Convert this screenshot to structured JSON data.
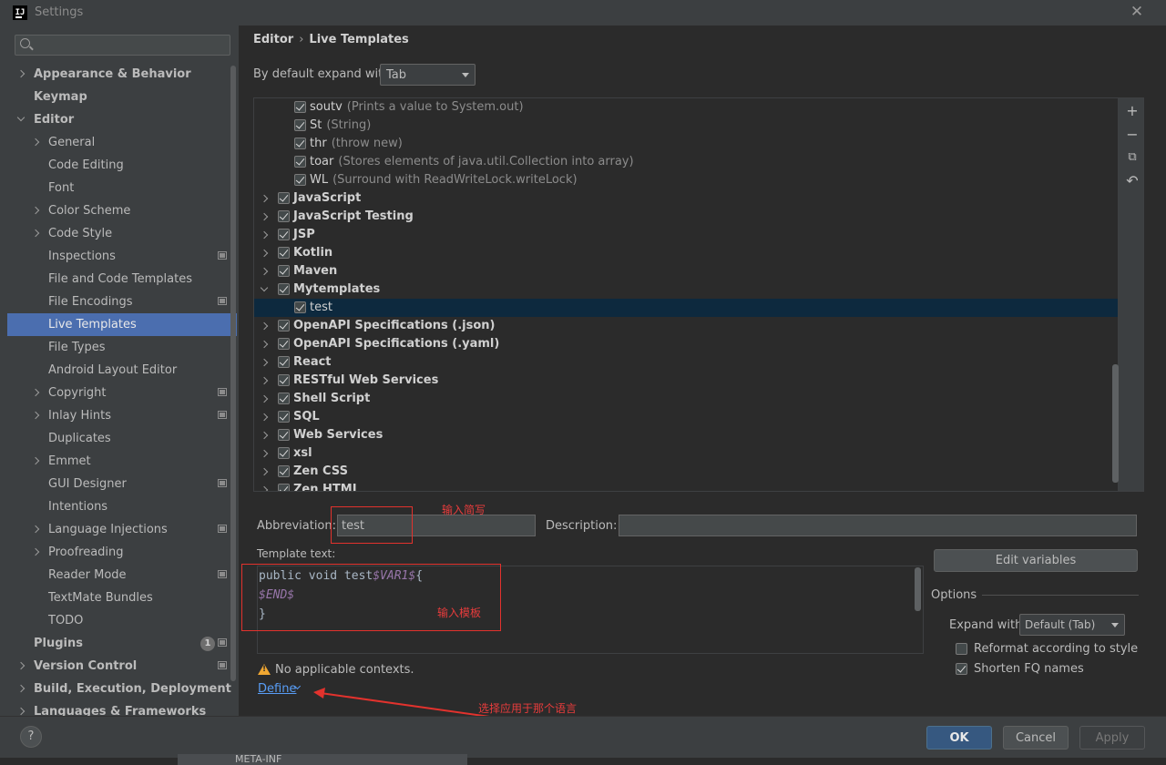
{
  "window": {
    "title": "Settings",
    "logo_text": "IJ",
    "close_glyph": "✕"
  },
  "search": {
    "placeholder": ""
  },
  "sidebar": {
    "items": [
      {
        "label": "Appearance & Behavior",
        "bold": true,
        "chevron": "closed",
        "indent": 0
      },
      {
        "label": "Keymap",
        "bold": true,
        "indent": 0
      },
      {
        "label": "Editor",
        "bold": true,
        "chevron": "open",
        "indent": 0
      },
      {
        "label": "General",
        "chevron": "closed",
        "indent": 1
      },
      {
        "label": "Code Editing",
        "indent": 1
      },
      {
        "label": "Font",
        "indent": 1
      },
      {
        "label": "Color Scheme",
        "chevron": "closed",
        "indent": 1
      },
      {
        "label": "Code Style",
        "chevron": "closed",
        "indent": 1
      },
      {
        "label": "Inspections",
        "indent": 1,
        "settings_icon": true
      },
      {
        "label": "File and Code Templates",
        "indent": 1
      },
      {
        "label": "File Encodings",
        "indent": 1,
        "settings_icon": true
      },
      {
        "label": "Live Templates",
        "indent": 1,
        "selected": true
      },
      {
        "label": "File Types",
        "indent": 1
      },
      {
        "label": "Android Layout Editor",
        "indent": 1
      },
      {
        "label": "Copyright",
        "chevron": "closed",
        "indent": 1,
        "settings_icon": true
      },
      {
        "label": "Inlay Hints",
        "chevron": "closed",
        "indent": 1,
        "settings_icon": true
      },
      {
        "label": "Duplicates",
        "indent": 1
      },
      {
        "label": "Emmet",
        "chevron": "closed",
        "indent": 1
      },
      {
        "label": "GUI Designer",
        "indent": 1,
        "settings_icon": true
      },
      {
        "label": "Intentions",
        "indent": 1
      },
      {
        "label": "Language Injections",
        "chevron": "closed",
        "indent": 1,
        "settings_icon": true
      },
      {
        "label": "Proofreading",
        "chevron": "closed",
        "indent": 1
      },
      {
        "label": "Reader Mode",
        "indent": 1,
        "settings_icon": true
      },
      {
        "label": "TextMate Bundles",
        "indent": 1
      },
      {
        "label": "TODO",
        "indent": 1
      },
      {
        "label": "Plugins",
        "bold": true,
        "indent": 0,
        "badge": "1",
        "settings_icon": true
      },
      {
        "label": "Version Control",
        "bold": true,
        "chevron": "closed",
        "indent": 0,
        "settings_icon": true
      },
      {
        "label": "Build, Execution, Deployment",
        "bold": true,
        "chevron": "closed",
        "indent": 0
      },
      {
        "label": "Languages & Frameworks",
        "bold": true,
        "chevron": "closed",
        "indent": 0
      }
    ]
  },
  "breadcrumb": {
    "parent": "Editor",
    "separator": "›",
    "current": "Live Templates"
  },
  "expand_default": {
    "label": "By default expand with",
    "value": "Tab"
  },
  "tree": {
    "rows": [
      {
        "type": "item",
        "name": "soutv",
        "desc": "(Prints a value to System.out)"
      },
      {
        "type": "item",
        "name": "St",
        "desc": "(String)"
      },
      {
        "type": "item",
        "name": "thr",
        "desc": "(throw new)"
      },
      {
        "type": "item",
        "name": "toar",
        "desc": "(Stores elements of java.util.Collection into array)"
      },
      {
        "type": "item",
        "name": "WL",
        "desc": "(Surround with ReadWriteLock.writeLock)"
      },
      {
        "type": "group",
        "name": "JavaScript",
        "open": false
      },
      {
        "type": "group",
        "name": "JavaScript Testing",
        "open": false
      },
      {
        "type": "group",
        "name": "JSP",
        "open": false
      },
      {
        "type": "group",
        "name": "Kotlin",
        "open": false
      },
      {
        "type": "group",
        "name": "Maven",
        "open": false
      },
      {
        "type": "group",
        "name": "Mytemplates",
        "open": true
      },
      {
        "type": "item",
        "name": "test",
        "desc": "",
        "selected": true
      },
      {
        "type": "group",
        "name": "OpenAPI Specifications (.json)",
        "open": false
      },
      {
        "type": "group",
        "name": "OpenAPI Specifications (.yaml)",
        "open": false
      },
      {
        "type": "group",
        "name": "React",
        "open": false
      },
      {
        "type": "group",
        "name": "RESTful Web Services",
        "open": false
      },
      {
        "type": "group",
        "name": "Shell Script",
        "open": false
      },
      {
        "type": "group",
        "name": "SQL",
        "open": false
      },
      {
        "type": "group",
        "name": "Web Services",
        "open": false
      },
      {
        "type": "group",
        "name": "xsl",
        "open": false
      },
      {
        "type": "group",
        "name": "Zen CSS",
        "open": false
      },
      {
        "type": "group",
        "name": "Zen HTML",
        "open": false
      }
    ],
    "toolbar": {
      "add": "+",
      "remove": "−",
      "copy": "⧉",
      "restore": "↶"
    }
  },
  "editor": {
    "abbreviation_label": "Abbreviation:",
    "abbreviation_value": "test",
    "description_label": "Description:",
    "description_value": "",
    "template_text_label": "Template text:",
    "code_lines": [
      [
        {
          "t": "public void test",
          "c": "plain"
        },
        {
          "t": "$VAR1$",
          "c": "var"
        },
        {
          "t": "{",
          "c": "plain"
        }
      ],
      [
        {
          "t": "$END$",
          "c": "var"
        }
      ],
      [
        {
          "t": "}",
          "c": "plain"
        }
      ]
    ],
    "edit_variables_label": "Edit variables",
    "options_label": "Options",
    "expand_with_label": "Expand with",
    "expand_with_value": "Default (Tab)",
    "reformat_label": "Reformat according to style",
    "reformat_checked": false,
    "shorten_label": "Shorten FQ names",
    "shorten_checked": true,
    "warning_text": "No applicable contexts.",
    "define_label": "Define"
  },
  "annotations": {
    "abbr_note": "输入简写",
    "template_note": "输入模板",
    "define_note": "选择应用于那个语言",
    "color": "#e2322d"
  },
  "footer": {
    "help": "?",
    "ok": "OK",
    "cancel": "Cancel",
    "apply": "Apply"
  },
  "background_tab": {
    "label": "META-INF"
  },
  "colors": {
    "selection": "#4b6eaf",
    "tree_selection": "#0d293e",
    "link": "#589df6",
    "ok_button": "#365880",
    "warning": "#f0a732"
  }
}
